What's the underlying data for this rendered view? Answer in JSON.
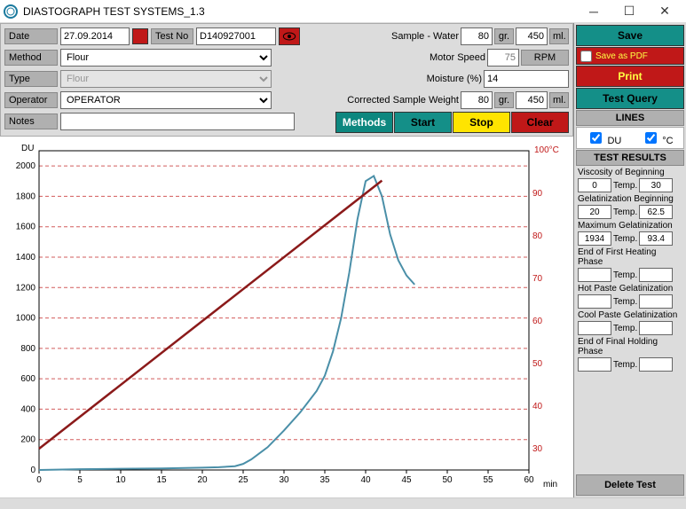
{
  "window": {
    "title": "DIASTOGRAPH TEST SYSTEMS_1.3"
  },
  "form": {
    "date_label": "Date",
    "date_value": "27.09.2014",
    "testno_label": "Test No",
    "testno_value": "D140927001",
    "method_label": "Method",
    "method_value": "Flour",
    "type_label": "Type",
    "type_value": "Flour",
    "operator_label": "Operator",
    "operator_value": "OPERATOR",
    "notes_label": "Notes",
    "notes_value": "",
    "sample_water_label": "Sample - Water",
    "sample_gr": "80",
    "sample_ml": "450",
    "motor_label": "Motor Speed",
    "motor_value": "75",
    "motor_unit": "RPM",
    "moisture_label": "Moisture (%)",
    "moisture_value": "14",
    "corrected_label": "Corrected Sample Weight",
    "corrected_gr": "80",
    "corrected_ml": "450",
    "unit_gr": "gr.",
    "unit_ml": "ml."
  },
  "buttons": {
    "methods": "Methods",
    "start": "Start",
    "stop": "Stop",
    "clear": "Clear",
    "save": "Save",
    "save_pdf": "Save as PDF",
    "print": "Print",
    "test_query": "Test Query",
    "delete_test": "Delete Test"
  },
  "lines": {
    "header": "LINES",
    "du": "DU",
    "celsius": "°C"
  },
  "results": {
    "header": "TEST RESULTS",
    "temp_label": "Temp.",
    "groups": [
      {
        "label": "Viscosity of Beginning",
        "v": "0",
        "t": "30"
      },
      {
        "label": "Gelatinization Beginning",
        "v": "20",
        "t": "62.5"
      },
      {
        "label": "Maximum Gelatinization",
        "v": "1934",
        "t": "93.4"
      },
      {
        "label": "End of First Heating Phase",
        "v": "",
        "t": ""
      },
      {
        "label": "Hot Paste Gelatinization",
        "v": "",
        "t": ""
      },
      {
        "label": "Cool Paste Gelatinization",
        "v": "",
        "t": ""
      },
      {
        "label": "End of Final Holding Phase",
        "v": "",
        "t": ""
      }
    ]
  },
  "chart_data": {
    "type": "line",
    "xlabel": "min",
    "y_left_label": "DU",
    "y_right_label": "100°C",
    "x_ticks": [
      0,
      5,
      10,
      15,
      20,
      25,
      30,
      35,
      40,
      45,
      50,
      55,
      60
    ],
    "y_left_ticks": [
      0,
      200,
      400,
      600,
      800,
      1000,
      1200,
      1400,
      1600,
      1800,
      2000
    ],
    "y_right_ticks": [
      30,
      40,
      50,
      60,
      70,
      80,
      90
    ],
    "xlim": [
      0,
      60
    ],
    "y_left_lim": [
      0,
      2100
    ],
    "y_right_lim": [
      25,
      100
    ],
    "series": [
      {
        "name": "DU",
        "axis": "left",
        "color": "#4a8fa8",
        "x": [
          0,
          5,
          10,
          15,
          20,
          22,
          24,
          25,
          26,
          28,
          30,
          32,
          34,
          35,
          36,
          37,
          38,
          39,
          40,
          41,
          42,
          43,
          44,
          45,
          46
        ],
        "values": [
          0,
          5,
          8,
          10,
          15,
          18,
          25,
          40,
          70,
          150,
          260,
          380,
          520,
          620,
          780,
          1000,
          1300,
          1650,
          1900,
          1934,
          1800,
          1550,
          1380,
          1280,
          1220
        ]
      },
      {
        "name": "Temperature",
        "axis": "right",
        "color": "#8b1a1a",
        "x": [
          0,
          42
        ],
        "values": [
          30,
          93
        ]
      }
    ]
  }
}
